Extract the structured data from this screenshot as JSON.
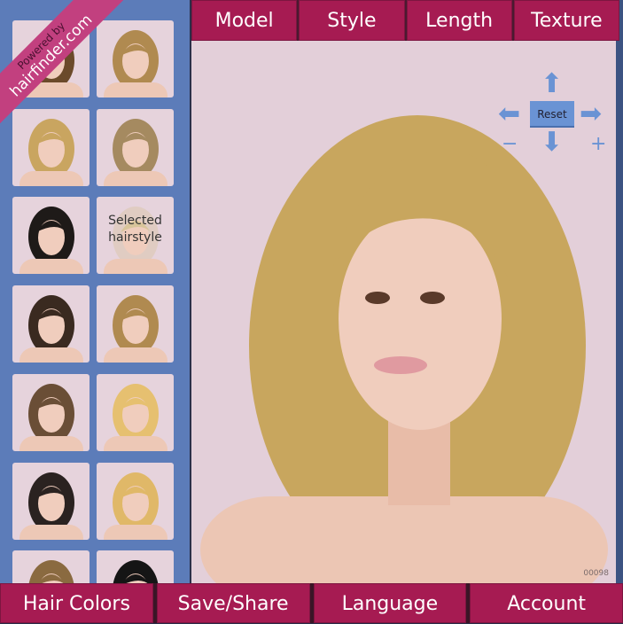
{
  "branding": {
    "powered_by": "Powered by",
    "site": "hairfinder.com"
  },
  "top_nav": [
    "Model",
    "Style",
    "Length",
    "Texture"
  ],
  "bottom_nav": [
    "Hair Colors",
    "Save/Share",
    "Language",
    "Account"
  ],
  "controls": {
    "reset": "Reset",
    "zoom_out": "−",
    "zoom_in": "+"
  },
  "thumbnails": {
    "selected_label": "Selected hairstyle",
    "hair_colors": [
      "#6b4a2a",
      "#b08a50",
      "#c9a560",
      "#a58a60",
      "#1e1a18",
      "#d8c49a",
      "#3a2a20",
      "#b08a50",
      "#6a4e36",
      "#e6c070",
      "#2a2220",
      "#e0b868",
      "#8a6a40",
      "#151515"
    ]
  },
  "preview": {
    "code": "00098",
    "hair_color": "#c8a65e"
  },
  "colors": {
    "accent": "#a61b52",
    "sidebar": "#5c7cb9",
    "canvas": "#e3cfd9",
    "control": "#6a93d4"
  }
}
